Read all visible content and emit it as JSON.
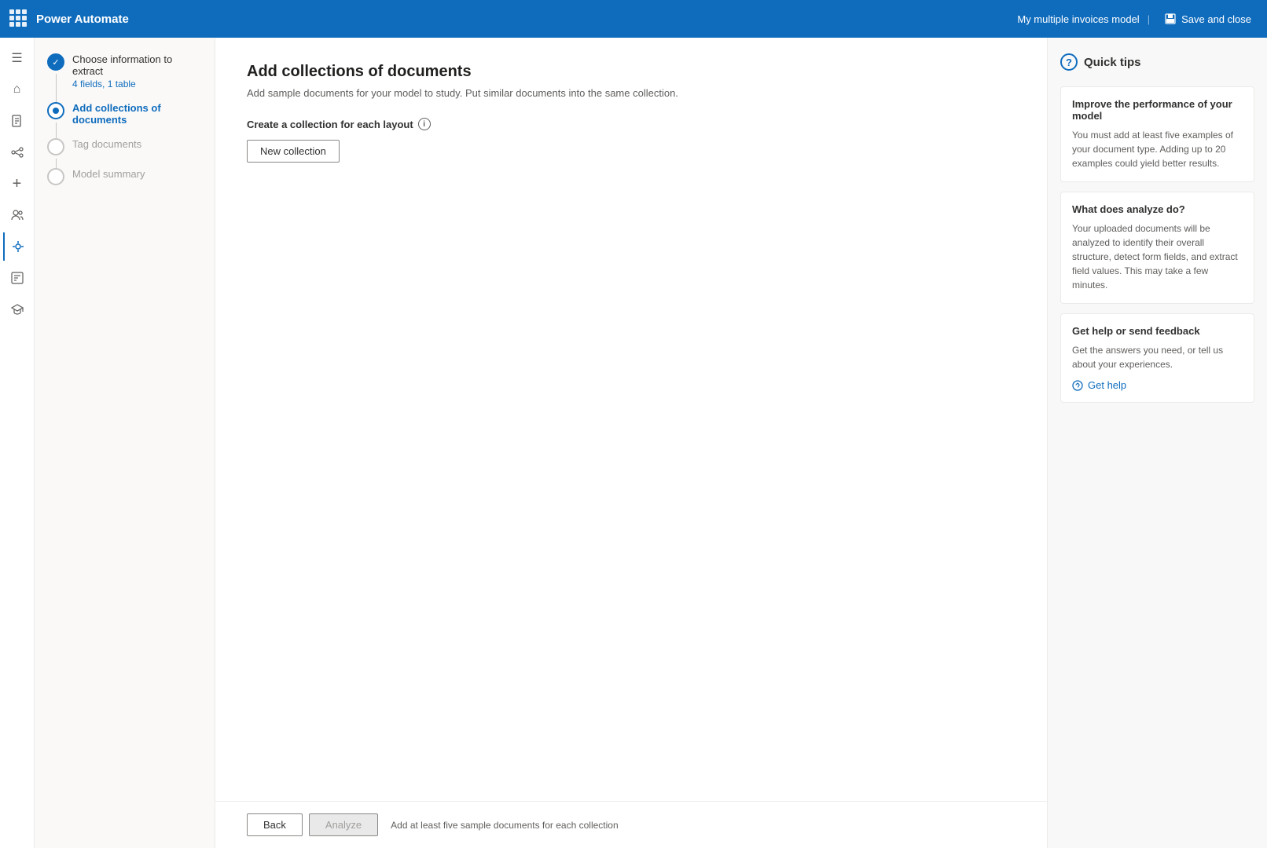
{
  "topbar": {
    "app_title": "Power Automate",
    "model_name": "My multiple invoices model",
    "save_close_label": "Save and close"
  },
  "steps": [
    {
      "id": "choose-info",
      "title": "Choose information to extract",
      "subtitle": "4 fields, 1 table",
      "state": "completed"
    },
    {
      "id": "add-collections",
      "title": "Add collections of documents",
      "subtitle": "",
      "state": "active"
    },
    {
      "id": "tag-documents",
      "title": "Tag documents",
      "subtitle": "",
      "state": "inactive"
    },
    {
      "id": "model-summary",
      "title": "Model summary",
      "subtitle": "",
      "state": "inactive"
    }
  ],
  "main": {
    "page_title": "Add collections of documents",
    "page_subtitle": "Add sample documents for your model to study. Put similar documents into the same collection.",
    "section_label": "Create a collection for each layout",
    "new_collection_label": "New collection"
  },
  "tips": {
    "header": "Quick tips",
    "cards": [
      {
        "title": "Improve the performance of your model",
        "body": "You must add at least five examples of your document type. Adding up to 20 examples could yield better results."
      },
      {
        "title": "What does analyze do?",
        "body": "Your uploaded documents will be analyzed to identify their overall structure, detect form fields, and extract field values. This may take a few minutes."
      },
      {
        "title": "Get help or send feedback",
        "body": "Get the answers you need, or tell us about your experiences."
      }
    ],
    "get_help_label": "Get help"
  },
  "footer": {
    "back_label": "Back",
    "analyze_label": "Analyze",
    "hint": "Add at least five sample documents for each collection"
  },
  "nav_icons": [
    "☰",
    "🏠",
    "📄",
    "🔗",
    "+",
    "👥",
    "🚀",
    "📋",
    "📚"
  ]
}
